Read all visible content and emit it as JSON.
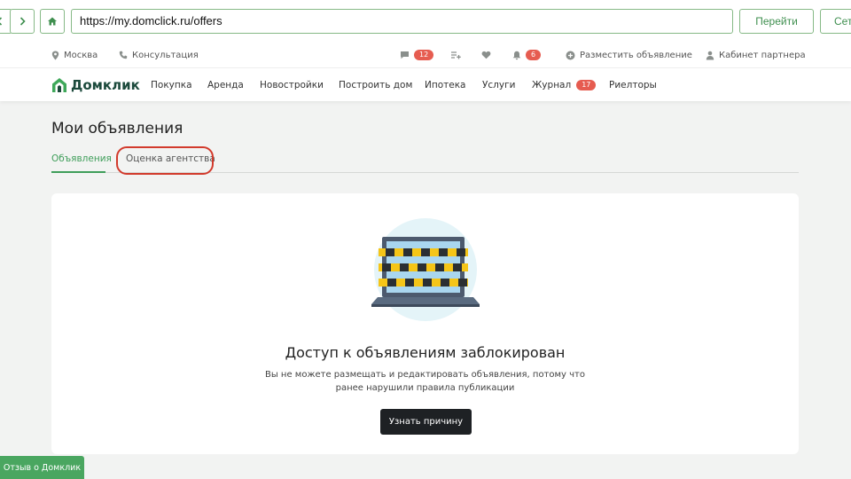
{
  "browser": {
    "url": "https://my.domclick.ru/offers",
    "go_label": "Перейти",
    "extra_label": "Сет"
  },
  "topbar": {
    "city": "Москва",
    "consult": "Консультация",
    "messages_count": "12",
    "notifications_count": "6",
    "post_ad": "Разместить объявление",
    "partner": "Кабинет партнера"
  },
  "nav": {
    "logo": "Домклик",
    "items": [
      "Покупка",
      "Аренда",
      "Новостройки",
      "Построить дом",
      "Ипотека",
      "Услуги",
      "Журнал",
      "Риелторы"
    ],
    "journal_badge": "17"
  },
  "page": {
    "title": "Мои объявления",
    "tabs": [
      "Объявления",
      "Оценка агентства"
    ]
  },
  "card": {
    "title": "Доступ к объявлениям заблокирован",
    "text_line1": "Вы не можете размещать и редактировать объявления, потому что",
    "text_line2": "ранее нарушили правила публикации",
    "button": "Узнать причину"
  },
  "feedback": "Отзыв о Домклик",
  "colors": {
    "accent": "#3f9e5a",
    "badge": "#e65c50",
    "highlight": "#d23a2c",
    "button_dark": "#1e2124"
  }
}
